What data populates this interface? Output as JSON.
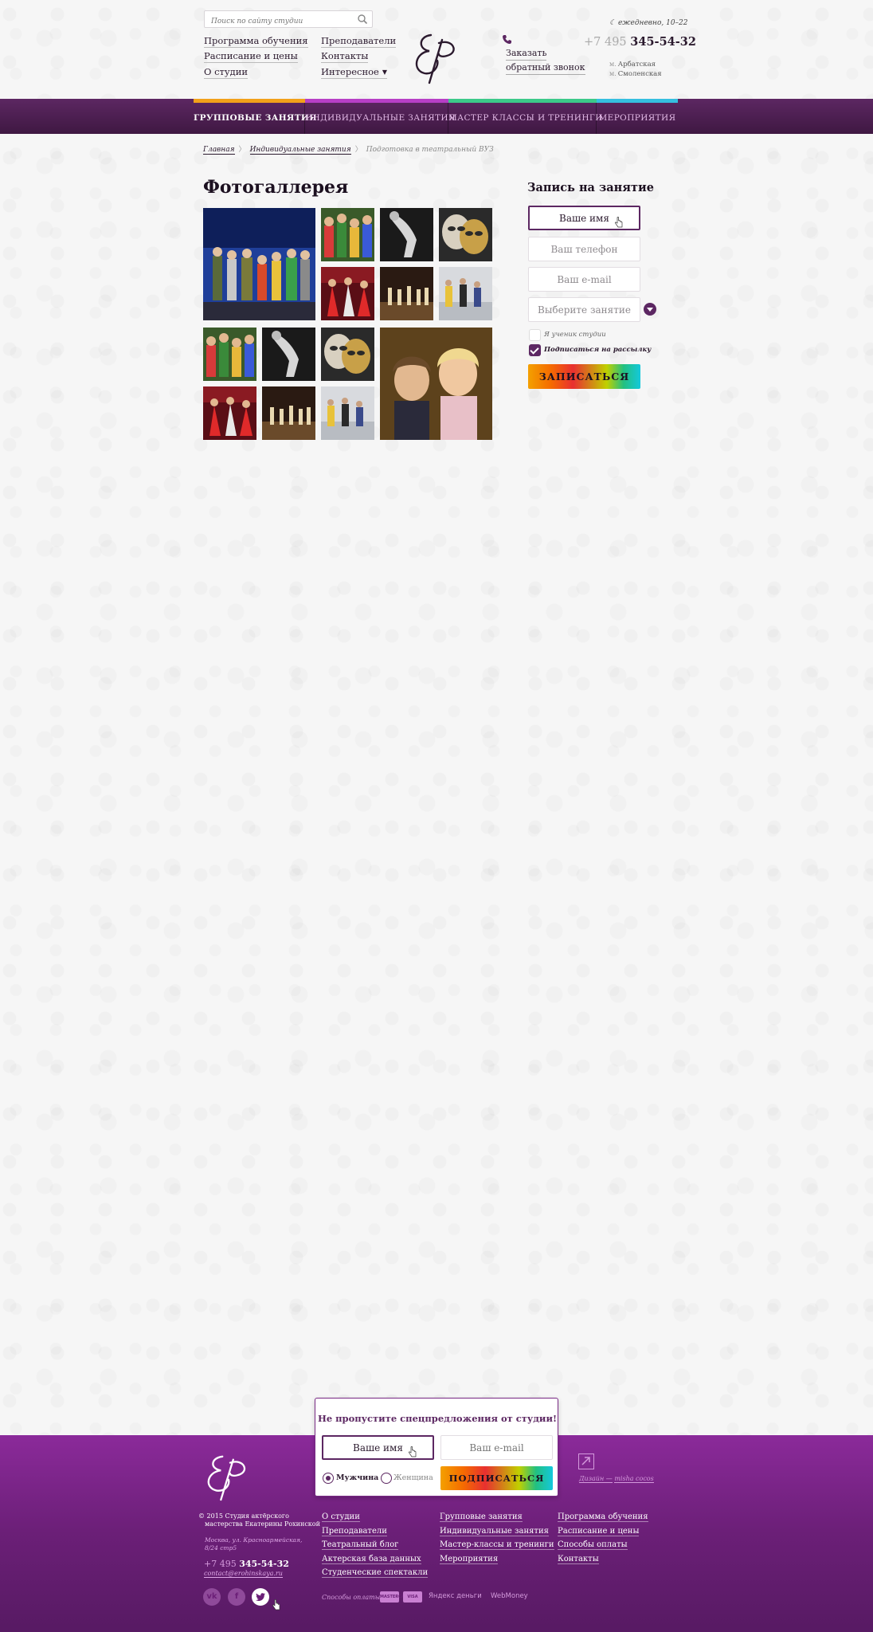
{
  "header": {
    "search_placeholder": "Поиск по сайту студии",
    "links_left": [
      "Программа обучения",
      "Расписание и цены",
      "О студии"
    ],
    "links_mid": [
      "Преподаватели",
      "Контакты",
      "Интересное"
    ],
    "callback": [
      "Заказать",
      "обратный звонок"
    ],
    "hours": "ежедневно, 10–22",
    "phone_code": "+7 495",
    "phone_number": "345-54-32",
    "metro": [
      "Арбатская",
      "Смоленская"
    ],
    "metro_mark": "м."
  },
  "nav": {
    "items": [
      "ГРУППОВЫЕ ЗАНЯТИЯ",
      "ИНДИВИДУАЛЬНЫЕ ЗАНЯТИЯ",
      "МАСТЕР КЛАССЫ И ТРЕНИНГИ",
      "МЕРОПРИЯТИЯ"
    ],
    "strip_colors": [
      "#f2a11a",
      "#b73fc6",
      "#3cc98a",
      "#35bfe0"
    ],
    "bg_color": "#5c2762"
  },
  "breadcrumb": {
    "items": [
      "Главная",
      "Индивидуальные занятия"
    ],
    "current": "Подготовка в театральный ВУЗ",
    "separator": "〉"
  },
  "gallery": {
    "title": "Фотогаллерея",
    "photos": [
      "stage-performance",
      "costumed-group",
      "dancer-bw",
      "theatre-mask",
      "red-dress-dancers",
      "stage-scene",
      "rehearsal",
      "costumed-group",
      "dancer-bw",
      "theatre-mask",
      "children-portrait",
      "red-dress-dancers",
      "stage-scene",
      "rehearsal"
    ]
  },
  "signup": {
    "title": "Запись на занятие",
    "name_placeholder": "Ваше имя",
    "phone_placeholder": "Ваш телефон",
    "email_placeholder": "Ваш e-mail",
    "class_placeholder": "Выберите занятие",
    "student_label": "Я ученик студии",
    "student_checked": false,
    "newsletter_label": "Подписаться на рассылку",
    "newsletter_checked": true,
    "submit_label": "ЗАПИСАТЬСЯ"
  },
  "popup": {
    "title": "Не пропустите спецпредложения от студии!",
    "name_placeholder": "Ваше имя",
    "email_placeholder": "Ваш e-mail",
    "gender_male": "Мужчина",
    "gender_female": "Женщина",
    "selected_gender": "male",
    "submit_label": "ПОДПИСАТЬСЯ"
  },
  "footer": {
    "copyright": [
      "© 2015 Студия актёрского",
      "мастерства Екатерины Рохинской"
    ],
    "address": [
      "Москва, ул. Красноармейская,",
      "8/24 стр5"
    ],
    "phone_code": "+7 495",
    "phone_number": "345-54-32",
    "email": "contact@erohinskaya.ru",
    "col1": [
      "О студии",
      "Преподаватели",
      "Театральный блог",
      "Актерская база данных",
      "Студенческие спектакли"
    ],
    "col2": [
      "Групповые занятия",
      "Индивидуальные занятия",
      "Мастер-классы и тренинги",
      "Мероприятия"
    ],
    "col3": [
      "Программа обучения",
      "Расписание и цены",
      "Способы оплаты",
      "Контакты"
    ],
    "payment_label": "Способы оплаты:",
    "payments": [
      "MASTERCARD",
      "VISA",
      "Яндекс деньги",
      "WebMoney"
    ],
    "design_credit_prefix": "Дизайн —",
    "design_credit_name": "misha cocos",
    "social": [
      "vk",
      "f",
      "twitter"
    ],
    "bg_color": "#6b1f77"
  }
}
